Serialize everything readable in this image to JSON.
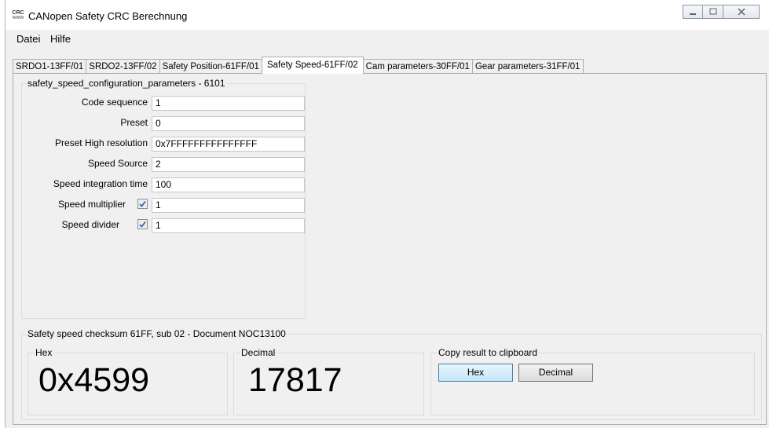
{
  "window": {
    "icon_text_top": "CRC",
    "icon_text_bottom": "WWW",
    "title": "CANopen Safety CRC Berechnung"
  },
  "menu": [
    "Datei",
    "Hilfe"
  ],
  "tabs": [
    "SRDO1-13FF/01",
    "SRDO2-13FF/02",
    "Safety Position-61FF/01",
    "Safety Speed-61FF/02",
    "Cam parameters-30FF/01",
    "Gear parameters-31FF/01"
  ],
  "active_tab_index": 3,
  "config_group": {
    "title": "safety_speed_configuration_parameters - 6101",
    "fields": [
      {
        "label": "Code sequence",
        "value": "1"
      },
      {
        "label": "Preset",
        "value": "0"
      },
      {
        "label": "Preset High resolution",
        "value": "0x7FFFFFFFFFFFFFFF"
      },
      {
        "label": "Speed Source",
        "value": "2"
      },
      {
        "label": "Speed integration time",
        "value": "100"
      },
      {
        "label": "Speed multiplier",
        "value": "1",
        "checked": true
      },
      {
        "label": "Speed divider",
        "value": "1",
        "checked": true
      }
    ]
  },
  "checksum_group": {
    "title": "Safety speed checksum 61FF, sub 02 - Document NOC13100",
    "hex_label": "Hex",
    "hex_value": "0x4599",
    "decimal_label": "Decimal",
    "decimal_value": "17817",
    "copy_label": "Copy result to clipboard",
    "copy_hex_button": "Hex",
    "copy_decimal_button": "Decimal"
  },
  "colors": {
    "accent": "#3c7fb1",
    "window_bg": "#f0f0f0"
  }
}
